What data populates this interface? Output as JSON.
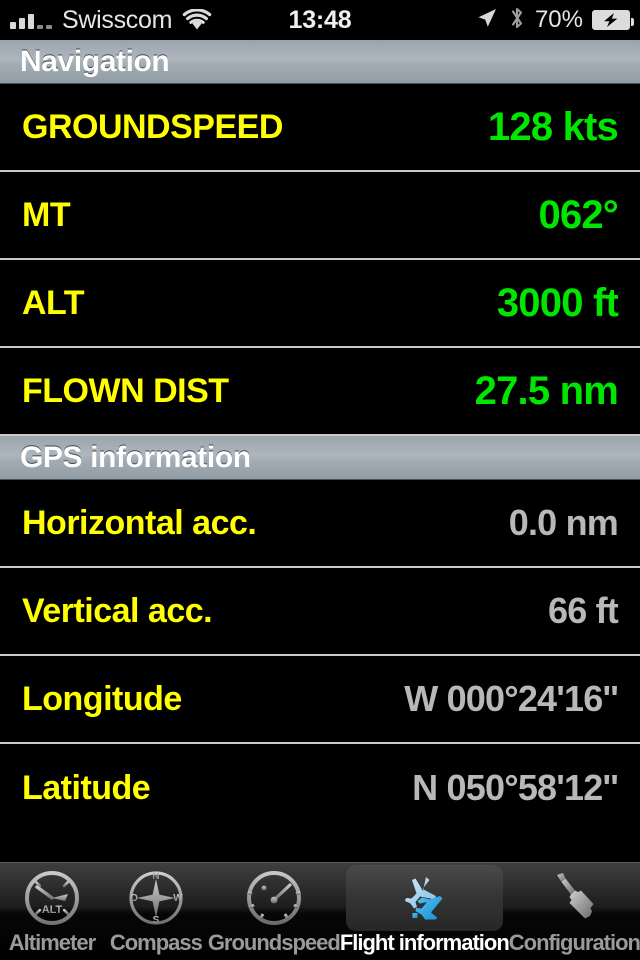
{
  "status_bar": {
    "carrier": "Swisscom",
    "signal_bars_filled": 3,
    "signal_bars_empty": 2,
    "wifi_icon": "wifi-icon",
    "time": "13:48",
    "location_icon": "location-arrow-icon",
    "bluetooth_icon": "bluetooth-icon",
    "battery_percent": "70%",
    "battery_icon": "battery-charging-icon"
  },
  "sections": [
    {
      "title": "Navigation",
      "rows": [
        {
          "label": "GROUNDSPEED",
          "value": "128 kts",
          "value_style": "green"
        },
        {
          "label": "MT",
          "value": "062°",
          "value_style": "green"
        },
        {
          "label": "ALT",
          "value": "3000 ft",
          "value_style": "green"
        },
        {
          "label": "FLOWN DIST",
          "value": "27.5 nm",
          "value_style": "green"
        }
      ]
    },
    {
      "title": "GPS information",
      "rows": [
        {
          "label": "Horizontal acc.",
          "value": "0.0 nm",
          "value_style": "grey"
        },
        {
          "label": "Vertical acc.",
          "value": "66 ft",
          "value_style": "grey"
        },
        {
          "label": "Longitude",
          "value": "W 000°24'16''",
          "value_style": "grey"
        },
        {
          "label": "Latitude",
          "value": "N 050°58'12''",
          "value_style": "grey"
        }
      ]
    }
  ],
  "tab_bar": {
    "tabs": [
      {
        "label": "Altimeter",
        "icon": "altimeter-dial-icon",
        "selected": false
      },
      {
        "label": "Compass",
        "icon": "compass-rose-icon",
        "selected": false
      },
      {
        "label": "Groundspeed",
        "icon": "speedometer-icon",
        "selected": false
      },
      {
        "label": "Flight information",
        "icon": "airplane-icon",
        "selected": true
      },
      {
        "label": "Configuration",
        "icon": "screwdriver-icon",
        "selected": false
      }
    ]
  },
  "colors": {
    "label_yellow": "#ffff00",
    "value_green": "#00e600",
    "value_grey": "#b8b8b8",
    "background": "#000000",
    "section_header": "#a3adb4",
    "tab_selected_accent": "#4fc3f7"
  }
}
